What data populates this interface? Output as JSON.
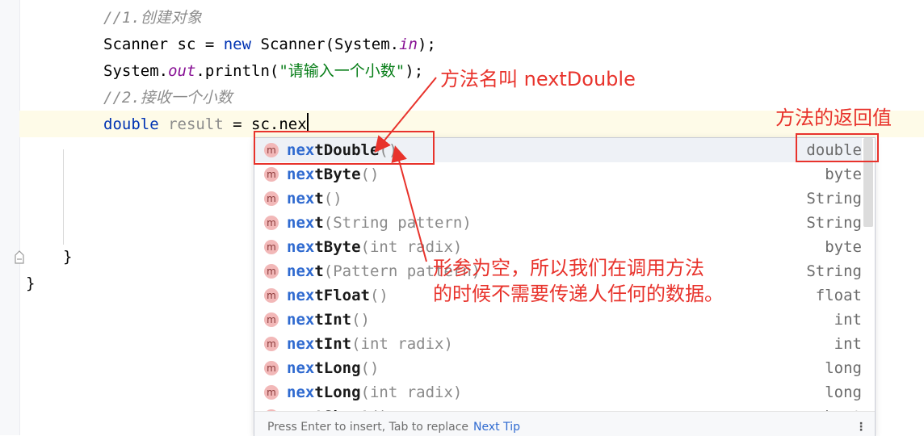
{
  "editor": {
    "line1_comment": "//1.创建对象",
    "line2": {
      "type": "Scanner",
      "var": " sc ",
      "eq": "= ",
      "new_kw": "new",
      "ctor": " Scanner(System.",
      "field": "in",
      "end": ");"
    },
    "line3": {
      "cls": "System.",
      "field": "out",
      "call": ".println(",
      "string": "\"请输入一个小数\"",
      "end": ");"
    },
    "line4_comment": "//2.接收一个小数",
    "line5": {
      "kw": "double",
      "var": " result",
      "rest": " = sc.nex"
    },
    "close_brace_inner": "}",
    "close_brace_outer": "}"
  },
  "completion": {
    "items": [
      {
        "match": "nex",
        "rest": "tDouble",
        "params": "()",
        "type": "double",
        "selected": true
      },
      {
        "match": "nex",
        "rest": "tByte",
        "params": "()",
        "type": "byte"
      },
      {
        "match": "nex",
        "rest": "t",
        "params": "()",
        "type": "String"
      },
      {
        "match": "nex",
        "rest": "t",
        "params": "(String pattern)",
        "type": "String"
      },
      {
        "match": "nex",
        "rest": "tByte",
        "params": "(int radix)",
        "type": "byte"
      },
      {
        "match": "nex",
        "rest": "t",
        "params": "(Pattern pattern)",
        "type": "String"
      },
      {
        "match": "nex",
        "rest": "tFloat",
        "params": "()",
        "type": "float"
      },
      {
        "match": "nex",
        "rest": "tInt",
        "params": "()",
        "type": "int"
      },
      {
        "match": "nex",
        "rest": "tInt",
        "params": "(int radix)",
        "type": "int"
      },
      {
        "match": "nex",
        "rest": "tLong",
        "params": "()",
        "type": "long"
      },
      {
        "match": "nex",
        "rest": "tLong",
        "params": "(int radix)",
        "type": "long"
      },
      {
        "match": "nex",
        "rest": "tShort",
        "params": "()",
        "type": "short"
      }
    ],
    "icon_letter": "m",
    "footer_hint": "Press Enter to insert, Tab to replace",
    "footer_tip": "Next Tip",
    "footer_menu": "⋮"
  },
  "annotations": {
    "method_name": "方法名叫 nextDouble",
    "return_value": "方法的返回值",
    "params_note_line1": "形参为空，所以我们在调用方法",
    "params_note_line2": "的时候不需要传递人任何的数据。",
    "color": "#e8332c"
  }
}
